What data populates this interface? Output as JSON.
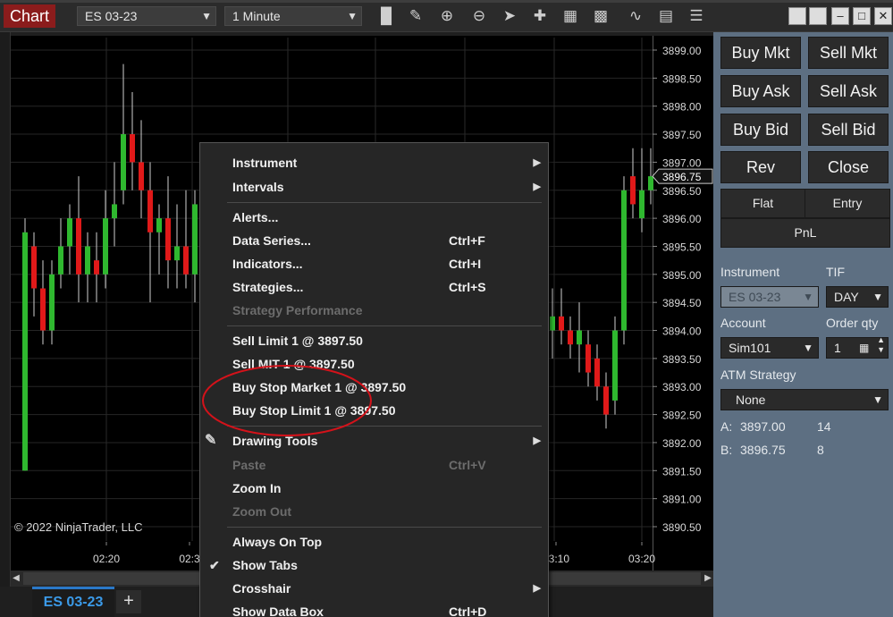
{
  "toolbar": {
    "title": "Chart",
    "instrument": "ES 03-23",
    "interval": "1 Minute",
    "tools": [
      "bar-type-icon",
      "pencil-icon",
      "zoom-in-icon",
      "zoom-out-icon",
      "pointer-icon",
      "crosshair-icon",
      "data-box-icon",
      "strategy-icon",
      "indicator-icon",
      "properties-icon"
    ]
  },
  "chart": {
    "copyright": "© 2022 NinjaTrader, LLC",
    "time_ticks": [
      "02:20",
      "02:3",
      "03:10",
      "03:20"
    ],
    "price_ticks": [
      "3899.00",
      "3898.50",
      "3898.00",
      "3897.50",
      "3897.00",
      "3896.50",
      "3896.00",
      "3895.50",
      "3895.00",
      "3894.50",
      "3894.00",
      "3893.50",
      "3893.00",
      "3892.50",
      "3892.00",
      "3891.50",
      "3891.00",
      "3890.50"
    ],
    "last_price": "3896.75",
    "up_color": "#2fb82f",
    "down_color": "#e01919"
  },
  "chart_data": {
    "type": "candlestick",
    "ylim": [
      3890.25,
      3899.2
    ],
    "candles": [
      {
        "o": 3891.5,
        "h": 3896.0,
        "l": 3891.5,
        "c": 3895.75
      },
      {
        "o": 3895.5,
        "h": 3895.75,
        "l": 3894.25,
        "c": 3894.75
      },
      {
        "o": 3894.75,
        "h": 3895.25,
        "l": 3893.75,
        "c": 3894.0
      },
      {
        "o": 3894.0,
        "h": 3895.25,
        "l": 3893.75,
        "c": 3895.0
      },
      {
        "o": 3895.0,
        "h": 3896.0,
        "l": 3894.75,
        "c": 3895.5
      },
      {
        "o": 3895.5,
        "h": 3896.25,
        "l": 3895.0,
        "c": 3896.0
      },
      {
        "o": 3896.0,
        "h": 3896.75,
        "l": 3894.5,
        "c": 3895.0
      },
      {
        "o": 3895.0,
        "h": 3895.75,
        "l": 3894.5,
        "c": 3895.5
      },
      {
        "o": 3895.25,
        "h": 3895.75,
        "l": 3894.5,
        "c": 3895.0
      },
      {
        "o": 3895.0,
        "h": 3896.5,
        "l": 3894.75,
        "c": 3896.0
      },
      {
        "o": 3896.0,
        "h": 3897.0,
        "l": 3895.5,
        "c": 3896.25
      },
      {
        "o": 3896.5,
        "h": 3898.75,
        "l": 3896.25,
        "c": 3897.5
      },
      {
        "o": 3897.5,
        "h": 3898.25,
        "l": 3896.5,
        "c": 3897.0
      },
      {
        "o": 3897.0,
        "h": 3897.75,
        "l": 3896.0,
        "c": 3896.5
      },
      {
        "o": 3896.5,
        "h": 3897.0,
        "l": 3894.5,
        "c": 3895.75
      },
      {
        "o": 3895.75,
        "h": 3896.25,
        "l": 3895.0,
        "c": 3896.0
      },
      {
        "o": 3896.0,
        "h": 3896.75,
        "l": 3894.75,
        "c": 3895.25
      },
      {
        "o": 3895.25,
        "h": 3896.25,
        "l": 3894.75,
        "c": 3895.5
      },
      {
        "o": 3895.5,
        "h": 3896.5,
        "l": 3894.75,
        "c": 3895.0
      },
      {
        "o": 3895.0,
        "h": 3896.5,
        "l": 3894.5,
        "c": 3896.25
      },
      {
        "o": 3896.5,
        "h": 3896.75,
        "l": 3894.25,
        "c": 3894.75
      },
      {
        "o": 3894.0,
        "h": 3894.75,
        "l": 3893.5,
        "c": 3894.25
      },
      {
        "o": 3894.25,
        "h": 3894.75,
        "l": 3893.75,
        "c": 3894.0
      },
      {
        "o": 3894.0,
        "h": 3894.25,
        "l": 3893.5,
        "c": 3893.75
      },
      {
        "o": 3893.75,
        "h": 3894.5,
        "l": 3893.25,
        "c": 3894.0
      },
      {
        "o": 3893.75,
        "h": 3894.0,
        "l": 3893.0,
        "c": 3893.25
      },
      {
        "o": 3893.5,
        "h": 3893.75,
        "l": 3892.75,
        "c": 3893.0
      },
      {
        "o": 3893.0,
        "h": 3893.25,
        "l": 3892.25,
        "c": 3892.5
      },
      {
        "o": 3892.75,
        "h": 3894.25,
        "l": 3892.5,
        "c": 3894.0
      },
      {
        "o": 3894.0,
        "h": 3896.75,
        "l": 3893.75,
        "c": 3896.5
      },
      {
        "o": 3896.75,
        "h": 3897.25,
        "l": 3896.0,
        "c": 3896.25
      },
      {
        "o": 3896.0,
        "h": 3897.25,
        "l": 3895.75,
        "c": 3896.5
      },
      {
        "o": 3896.5,
        "h": 3897.25,
        "l": 3896.25,
        "c": 3896.75
      }
    ]
  },
  "context_menu": {
    "items": [
      {
        "label": "Instrument",
        "shortcut": "",
        "submenu": true,
        "enabled": true
      },
      {
        "label": "Intervals",
        "shortcut": "",
        "submenu": true,
        "enabled": true
      },
      {
        "label": "Alerts...",
        "shortcut": "",
        "submenu": false,
        "enabled": true
      },
      {
        "label": "Data Series...",
        "shortcut": "Ctrl+F",
        "submenu": false,
        "enabled": true
      },
      {
        "label": "Indicators...",
        "shortcut": "Ctrl+I",
        "submenu": false,
        "enabled": true
      },
      {
        "label": "Strategies...",
        "shortcut": "Ctrl+S",
        "submenu": false,
        "enabled": true
      },
      {
        "label": "Strategy Performance",
        "shortcut": "",
        "submenu": false,
        "enabled": false
      },
      {
        "label": "Sell Limit 1 @ 3897.50",
        "shortcut": "",
        "submenu": false,
        "enabled": true
      },
      {
        "label": "Sell MIT 1 @ 3897.50",
        "shortcut": "",
        "submenu": false,
        "enabled": true
      },
      {
        "label": "Buy Stop Market 1 @ 3897.50",
        "shortcut": "",
        "submenu": false,
        "enabled": true
      },
      {
        "label": "Buy Stop Limit 1 @ 3897.50",
        "shortcut": "",
        "submenu": false,
        "enabled": true
      },
      {
        "label": "Drawing Tools",
        "shortcut": "",
        "submenu": true,
        "enabled": true
      },
      {
        "label": "Paste",
        "shortcut": "Ctrl+V",
        "submenu": false,
        "enabled": false
      },
      {
        "label": "Zoom In",
        "shortcut": "",
        "submenu": false,
        "enabled": true
      },
      {
        "label": "Zoom Out",
        "shortcut": "",
        "submenu": false,
        "enabled": false
      },
      {
        "label": "Always On Top",
        "shortcut": "",
        "submenu": false,
        "enabled": true
      },
      {
        "label": "Show Tabs",
        "shortcut": "",
        "submenu": false,
        "enabled": true,
        "checked": true
      },
      {
        "label": "Crosshair",
        "shortcut": "",
        "submenu": true,
        "enabled": true
      },
      {
        "label": "Show Data Box",
        "shortcut": "Ctrl+D",
        "submenu": false,
        "enabled": true
      }
    ],
    "highlight_color": "#d4121a"
  },
  "order_panel": {
    "buttons": {
      "buy_mkt": "Buy Mkt",
      "sell_mkt": "Sell Mkt",
      "buy_ask": "Buy Ask",
      "sell_ask": "Sell Ask",
      "buy_bid": "Buy Bid",
      "sell_bid": "Sell Bid",
      "rev": "Rev",
      "close": "Close"
    },
    "position": {
      "flat": "Flat",
      "entry": "Entry",
      "pnl": "PnL"
    },
    "labels": {
      "instrument": "Instrument",
      "tif": "TIF",
      "account": "Account",
      "order_qty": "Order qty",
      "atm_strategy": "ATM Strategy"
    },
    "values": {
      "instrument": "ES 03-23",
      "tif": "DAY",
      "account": "Sim101",
      "order_qty": "1",
      "atm_strategy": "None"
    },
    "quotes": {
      "ask_label": "A:",
      "ask_price": "3897.00",
      "ask_size": "14",
      "bid_label": "B:",
      "bid_price": "3896.75",
      "bid_size": "8"
    }
  },
  "tabs": {
    "active": "ES 03-23",
    "add": "+"
  }
}
